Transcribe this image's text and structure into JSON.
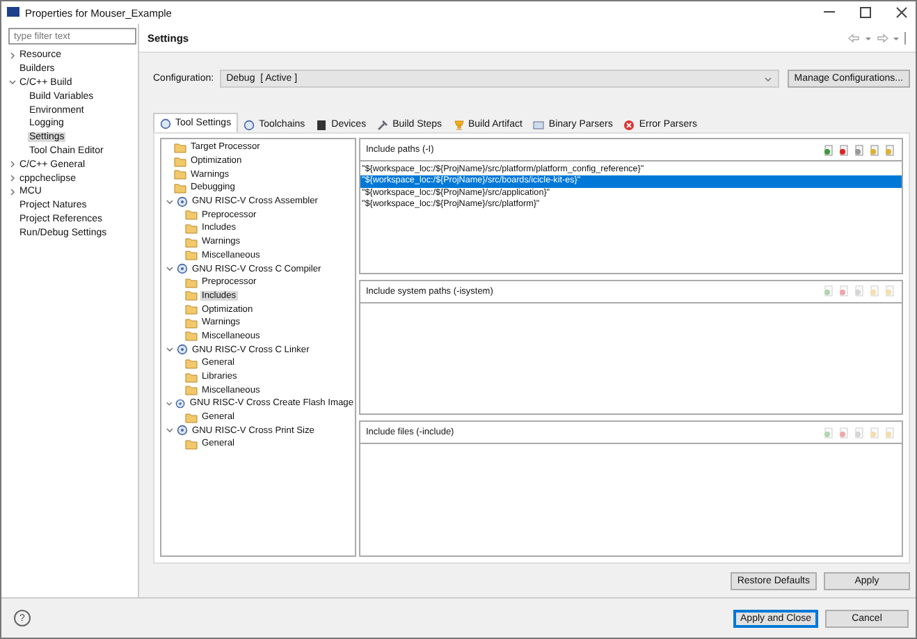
{
  "window": {
    "title": "Properties for Mouser_Example"
  },
  "filter": {
    "placeholder": "type filter text"
  },
  "nav": [
    {
      "label": "Resource",
      "expanded": false,
      "selected": false
    },
    {
      "label": "Builders",
      "selected": false
    },
    {
      "label": "C/C++ Build",
      "expanded": true,
      "selected": false,
      "children": [
        {
          "label": "Build Variables",
          "selected": false
        },
        {
          "label": "Environment",
          "selected": false
        },
        {
          "label": "Logging",
          "selected": false
        },
        {
          "label": "Settings",
          "selected": true
        },
        {
          "label": "Tool Chain Editor",
          "selected": false
        }
      ]
    },
    {
      "label": "C/C++ General",
      "expanded": false,
      "selected": false
    },
    {
      "label": "cppcheclipse",
      "expanded": false,
      "selected": false
    },
    {
      "label": "MCU",
      "expanded": false,
      "selected": false
    },
    {
      "label": "Project Natures",
      "selected": false
    },
    {
      "label": "Project References",
      "selected": false
    },
    {
      "label": "Run/Debug Settings",
      "selected": false
    }
  ],
  "page_title": "Settings",
  "configuration": {
    "label": "Configuration:",
    "value": "Debug  [ Active ]",
    "button": "Manage Configurations..."
  },
  "tabs": [
    {
      "label": "Tool Settings",
      "selected": true
    },
    {
      "label": "Toolchains",
      "selected": false
    },
    {
      "label": "Devices",
      "selected": false
    },
    {
      "label": "Build Steps",
      "selected": false
    },
    {
      "label": "Build Artifact",
      "selected": false
    },
    {
      "label": "Binary Parsers",
      "selected": false
    },
    {
      "label": "Error Parsers",
      "selected": false
    }
  ],
  "tool_tree": [
    {
      "kind": "category",
      "label": "Target Processor",
      "selected": false
    },
    {
      "kind": "category",
      "label": "Optimization",
      "selected": false
    },
    {
      "kind": "category",
      "label": "Warnings",
      "selected": false
    },
    {
      "kind": "category",
      "label": "Debugging",
      "selected": false
    },
    {
      "kind": "tool",
      "label": "GNU RISC-V Cross Assembler",
      "expanded": true,
      "selected": false,
      "children": [
        {
          "kind": "category",
          "label": "Preprocessor",
          "selected": false
        },
        {
          "kind": "category",
          "label": "Includes",
          "selected": false
        },
        {
          "kind": "category",
          "label": "Warnings",
          "selected": false
        },
        {
          "kind": "category",
          "label": "Miscellaneous",
          "selected": false
        }
      ]
    },
    {
      "kind": "tool",
      "label": "GNU RISC-V Cross C Compiler",
      "expanded": true,
      "selected": false,
      "children": [
        {
          "kind": "category",
          "label": "Preprocessor",
          "selected": false
        },
        {
          "kind": "category",
          "label": "Includes",
          "selected": true
        },
        {
          "kind": "category",
          "label": "Optimization",
          "selected": false
        },
        {
          "kind": "category",
          "label": "Warnings",
          "selected": false
        },
        {
          "kind": "category",
          "label": "Miscellaneous",
          "selected": false
        }
      ]
    },
    {
      "kind": "tool",
      "label": "GNU RISC-V Cross C Linker",
      "expanded": true,
      "selected": false,
      "children": [
        {
          "kind": "category",
          "label": "General",
          "selected": false
        },
        {
          "kind": "category",
          "label": "Libraries",
          "selected": false
        },
        {
          "kind": "category",
          "label": "Miscellaneous",
          "selected": false
        }
      ]
    },
    {
      "kind": "tool",
      "label": "GNU RISC-V Cross Create Flash Image",
      "expanded": true,
      "selected": false,
      "children": [
        {
          "kind": "category",
          "label": "General",
          "selected": false
        }
      ]
    },
    {
      "kind": "tool",
      "label": "GNU RISC-V Cross Print Size",
      "expanded": true,
      "selected": false,
      "children": [
        {
          "kind": "category",
          "label": "General",
          "selected": false
        }
      ]
    }
  ],
  "panels": [
    {
      "title": "Include paths (-I)",
      "tools_enabled": true,
      "items": [
        {
          "text": "\"${workspace_loc:/${ProjName}/src/platform/platform_config_reference}\"",
          "selected": false
        },
        {
          "text": "\"${workspace_loc:/${ProjName}/src/boards/icicle-kit-es}\"",
          "selected": true
        },
        {
          "text": "\"${workspace_loc:/${ProjName}/src/application}\"",
          "selected": false
        },
        {
          "text": "\"${workspace_loc:/${ProjName}/src/platform}\"",
          "selected": false
        }
      ]
    },
    {
      "title": "Include system paths (-isystem)",
      "tools_enabled": false
    },
    {
      "title": "Include files (-include)",
      "tools_enabled": false
    }
  ],
  "buttons": {
    "restore": "Restore Defaults",
    "apply": "Apply"
  },
  "footer": {
    "help": "?",
    "buttons": [
      {
        "label": "Apply and Close",
        "default": true
      },
      {
        "label": "Cancel",
        "default": false
      }
    ]
  }
}
